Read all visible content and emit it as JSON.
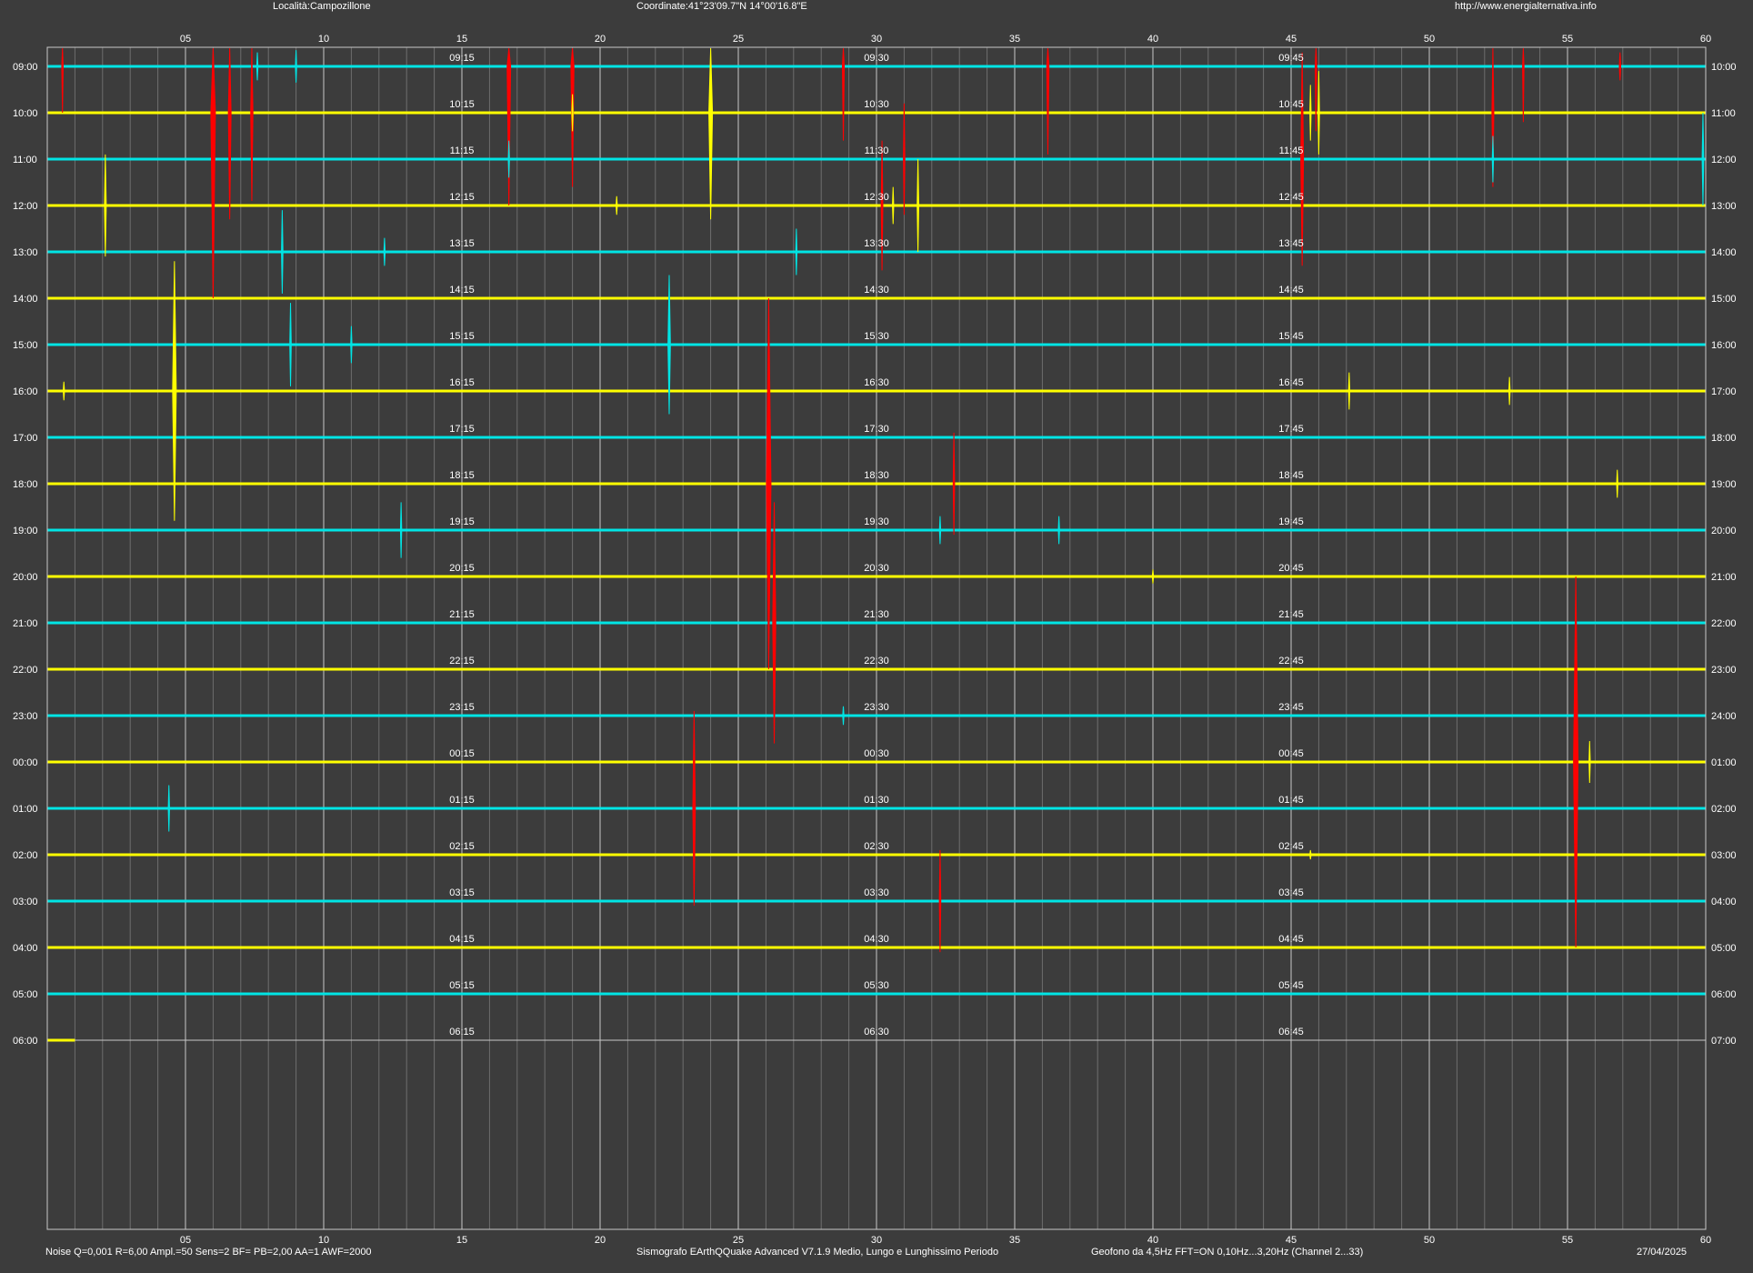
{
  "header": {
    "location": "Località:Campozillone",
    "coordinates": "Coordinate:41°23'09.7\"N 14°00'16.8\"E",
    "website": "http://www.energialternativa.info"
  },
  "footer": {
    "settings": "Noise Q=0,001 R=6,00 Ampl.=50 Sens=2 BF= PB=2,00 AA=1 AWF=2000",
    "software": "Sismografo  EArthQQuake Advanced V7.1.9  Medio, Lungo e Lunghissimo Periodo",
    "sensor": "Geofono da 4,5Hz FFT=ON 0,10Hz...3,20Hz      (Channel 2...33)",
    "date": "27/04/2025"
  },
  "colors": {
    "background": "#3c3c3c",
    "trace_a": "#00e5e5",
    "trace_b": "#ffff00",
    "event": "#ff0000",
    "grid_major": "#c8c8c8",
    "grid_minor": "#6e6e6e",
    "text": "#ffffff"
  },
  "chart_data": {
    "type": "line",
    "x_range": [
      0,
      60
    ],
    "x_unit": "minutes",
    "x_ticks": [
      "05",
      "10",
      "15",
      "20",
      "25",
      "30",
      "35",
      "40",
      "45",
      "50",
      "55",
      "60"
    ],
    "minor_grid_every_minutes": 1,
    "rows": [
      {
        "left": "09:00",
        "right": "10:00",
        "q15": "09:15",
        "q30": "09:30",
        "q45": "09:45"
      },
      {
        "left": "10:00",
        "right": "11:00",
        "q15": "10:15",
        "q30": "10:30",
        "q45": "10:45"
      },
      {
        "left": "11:00",
        "right": "12:00",
        "q15": "11:15",
        "q30": "11:30",
        "q45": "11:45"
      },
      {
        "left": "12:00",
        "right": "13:00",
        "q15": "12:15",
        "q30": "12:30",
        "q45": "12:45"
      },
      {
        "left": "13:00",
        "right": "14:00",
        "q15": "13:15",
        "q30": "13:30",
        "q45": "13:45"
      },
      {
        "left": "14:00",
        "right": "15:00",
        "q15": "14:15",
        "q30": "14:30",
        "q45": "14:45"
      },
      {
        "left": "15:00",
        "right": "16:00",
        "q15": "15:15",
        "q30": "15:30",
        "q45": "15:45"
      },
      {
        "left": "16:00",
        "right": "17:00",
        "q15": "16:15",
        "q30": "16:30",
        "q45": "16:45"
      },
      {
        "left": "17:00",
        "right": "18:00",
        "q15": "17:15",
        "q30": "17:30",
        "q45": "17:45"
      },
      {
        "left": "18:00",
        "right": "19:00",
        "q15": "18:15",
        "q30": "18:30",
        "q45": "18:45"
      },
      {
        "left": "19:00",
        "right": "20:00",
        "q15": "19:15",
        "q30": "19:30",
        "q45": "19:45"
      },
      {
        "left": "20:00",
        "right": "21:00",
        "q15": "20:15",
        "q30": "20:30",
        "q45": "20:45"
      },
      {
        "left": "21:00",
        "right": "22:00",
        "q15": "21:15",
        "q30": "21:30",
        "q45": "21:45"
      },
      {
        "left": "22:00",
        "right": "23:00",
        "q15": "22:15",
        "q30": "22:30",
        "q45": "22:45"
      },
      {
        "left": "23:00",
        "right": "24:00",
        "q15": "23:15",
        "q30": "23:30",
        "q45": "23:45"
      },
      {
        "left": "00:00",
        "right": "01:00",
        "q15": "00:15",
        "q30": "00:30",
        "q45": "00:45"
      },
      {
        "left": "01:00",
        "right": "02:00",
        "q15": "01:15",
        "q30": "01:30",
        "q45": "01:45"
      },
      {
        "left": "02:00",
        "right": "03:00",
        "q15": "02:15",
        "q30": "02:30",
        "q45": "02:45"
      },
      {
        "left": "03:00",
        "right": "04:00",
        "q15": "03:15",
        "q30": "03:30",
        "q45": "03:45"
      },
      {
        "left": "04:00",
        "right": "05:00",
        "q15": "04:15",
        "q30": "04:30",
        "q45": "04:45"
      },
      {
        "left": "05:00",
        "right": "06:00",
        "q15": "05:15",
        "q30": "05:30",
        "q45": "05:45"
      },
      {
        "left": "06:00",
        "right": "07:00",
        "q15": "06:15",
        "q30": "06:30",
        "q45": "06:45"
      }
    ],
    "last_row_end_minute": 1,
    "events": [
      {
        "row": 0,
        "minute": 0.55,
        "amp": 1.0,
        "color": "event"
      },
      {
        "row": 1,
        "minute": 6.0,
        "amp": 4.0,
        "color": "event"
      },
      {
        "row": 1,
        "minute": 7.4,
        "amp": 1.9,
        "color": "event"
      },
      {
        "row": 1,
        "minute": 6.6,
        "amp": 2.3,
        "color": "event"
      },
      {
        "row": 0,
        "minute": 16.7,
        "amp": 3.0,
        "color": "event"
      },
      {
        "row": 0,
        "minute": 19.0,
        "amp": 2.6,
        "color": "event"
      },
      {
        "row": 0,
        "minute": 28.8,
        "amp": 1.6,
        "color": "event"
      },
      {
        "row": 2,
        "minute": 31.0,
        "amp": 1.2,
        "color": "event"
      },
      {
        "row": 3,
        "minute": 30.2,
        "amp": 1.4,
        "color": "event"
      },
      {
        "row": 0,
        "minute": 36.2,
        "amp": 1.9,
        "color": "event"
      },
      {
        "row": 2,
        "minute": 45.4,
        "amp": 2.3,
        "color": "event"
      },
      {
        "row": 0,
        "minute": 45.9,
        "amp": 1.4,
        "color": "event"
      },
      {
        "row": 1,
        "minute": 52.3,
        "amp": 1.6,
        "color": "event"
      },
      {
        "row": 0,
        "minute": 53.4,
        "amp": 1.2,
        "color": "event"
      },
      {
        "row": 0,
        "minute": 56.9,
        "amp": 0.3,
        "color": "event"
      },
      {
        "row": 9,
        "minute": 26.1,
        "amp": 4.0,
        "color": "event"
      },
      {
        "row": 12,
        "minute": 26.3,
        "amp": 2.6,
        "color": "event"
      },
      {
        "row": 9,
        "minute": 32.8,
        "amp": 1.1,
        "color": "event"
      },
      {
        "row": 16,
        "minute": 23.4,
        "amp": 2.1,
        "color": "event"
      },
      {
        "row": 18,
        "minute": 32.3,
        "amp": 1.1,
        "color": "event"
      },
      {
        "row": 15,
        "minute": 55.3,
        "amp": 4.0,
        "color": "event"
      },
      {
        "row": 0,
        "minute": 9.0,
        "amp": 0.35,
        "color": "trace"
      },
      {
        "row": 0,
        "minute": 7.6,
        "amp": 0.3,
        "color": "trace"
      },
      {
        "row": 1,
        "minute": 24.0,
        "amp": 2.3,
        "color": "trace"
      },
      {
        "row": 1,
        "minute": 19.0,
        "amp": 0.4,
        "color": "trace"
      },
      {
        "row": 1,
        "minute": 45.7,
        "amp": 0.6,
        "color": "trace"
      },
      {
        "row": 1,
        "minute": 46.0,
        "amp": 0.9,
        "color": "trace"
      },
      {
        "row": 2,
        "minute": 16.7,
        "amp": 0.4,
        "color": "trace"
      },
      {
        "row": 2,
        "minute": 52.3,
        "amp": 0.5,
        "color": "trace"
      },
      {
        "row": 2,
        "minute": 59.9,
        "amp": 1.0,
        "color": "trace"
      },
      {
        "row": 3,
        "minute": 2.1,
        "amp": 1.1,
        "color": "trace"
      },
      {
        "row": 3,
        "minute": 31.5,
        "amp": 1.0,
        "color": "trace"
      },
      {
        "row": 3,
        "minute": 30.6,
        "amp": 0.4,
        "color": "trace"
      },
      {
        "row": 3,
        "minute": 20.6,
        "amp": 0.2,
        "color": "trace"
      },
      {
        "row": 4,
        "minute": 8.5,
        "amp": 0.9,
        "color": "trace"
      },
      {
        "row": 4,
        "minute": 12.2,
        "amp": 0.3,
        "color": "trace"
      },
      {
        "row": 4,
        "minute": 27.1,
        "amp": 0.5,
        "color": "trace"
      },
      {
        "row": 6,
        "minute": 8.8,
        "amp": 0.9,
        "color": "trace"
      },
      {
        "row": 6,
        "minute": 11.0,
        "amp": 0.4,
        "color": "trace"
      },
      {
        "row": 6,
        "minute": 22.5,
        "amp": 1.5,
        "color": "trace"
      },
      {
        "row": 7,
        "minute": 4.6,
        "amp": 2.8,
        "color": "trace"
      },
      {
        "row": 7,
        "minute": 0.6,
        "amp": 0.2,
        "color": "trace"
      },
      {
        "row": 7,
        "minute": 47.1,
        "amp": 0.4,
        "color": "trace"
      },
      {
        "row": 7,
        "minute": 52.9,
        "amp": 0.3,
        "color": "trace"
      },
      {
        "row": 9,
        "minute": 56.8,
        "amp": 0.3,
        "color": "trace"
      },
      {
        "row": 10,
        "minute": 12.8,
        "amp": 0.6,
        "color": "trace"
      },
      {
        "row": 10,
        "minute": 32.3,
        "amp": 0.3,
        "color": "trace"
      },
      {
        "row": 10,
        "minute": 36.6,
        "amp": 0.3,
        "color": "trace"
      },
      {
        "row": 11,
        "minute": 40.0,
        "amp": 0.15,
        "color": "trace"
      },
      {
        "row": 14,
        "minute": 28.8,
        "amp": 0.2,
        "color": "trace"
      },
      {
        "row": 15,
        "minute": 55.8,
        "amp": 0.45,
        "color": "trace"
      },
      {
        "row": 16,
        "minute": 4.4,
        "amp": 0.5,
        "color": "trace"
      },
      {
        "row": 17,
        "minute": 45.7,
        "amp": 0.1,
        "color": "trace"
      }
    ]
  }
}
